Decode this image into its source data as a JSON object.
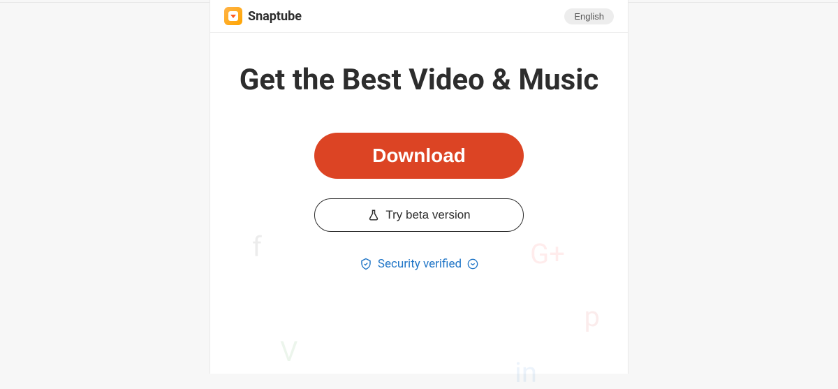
{
  "header": {
    "brand": "Snaptube",
    "language": "English"
  },
  "hero": {
    "title": "Get the Best Video & Music",
    "download_label": "Download",
    "beta_label": "Try beta version",
    "security_label": "Security verified"
  }
}
